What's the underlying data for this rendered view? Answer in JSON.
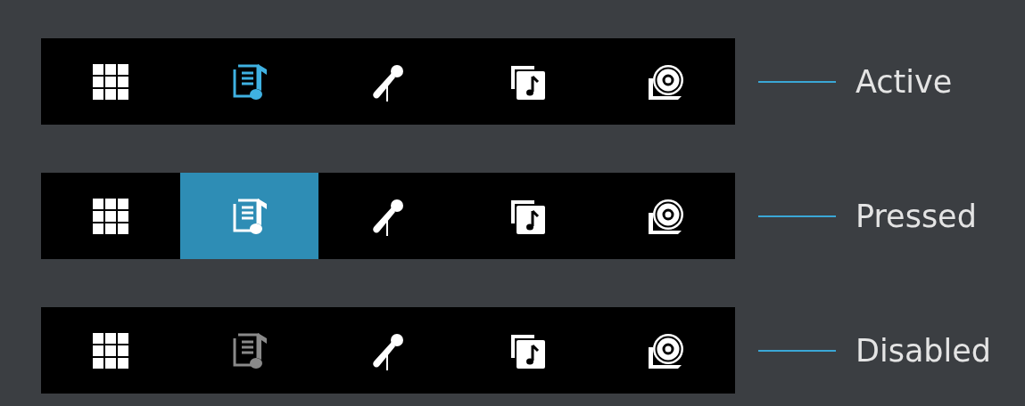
{
  "rows": [
    {
      "label": "Active",
      "kind": "active",
      "tabs": [
        {
          "kind": "grid",
          "selected": false
        },
        {
          "kind": "playlist",
          "selected": true
        },
        {
          "kind": "microphone",
          "selected": false
        },
        {
          "kind": "album",
          "selected": false
        },
        {
          "kind": "disc",
          "selected": false
        }
      ]
    },
    {
      "label": "Pressed",
      "kind": "pressed",
      "tabs": [
        {
          "kind": "grid",
          "selected": false
        },
        {
          "kind": "playlist",
          "selected": true
        },
        {
          "kind": "microphone",
          "selected": false
        },
        {
          "kind": "album",
          "selected": false
        },
        {
          "kind": "disc",
          "selected": false
        }
      ]
    },
    {
      "label": "Disabled",
      "kind": "disabled",
      "tabs": [
        {
          "kind": "grid",
          "selected": false
        },
        {
          "kind": "playlist",
          "selected": true
        },
        {
          "kind": "microphone",
          "selected": false
        },
        {
          "kind": "album",
          "selected": false
        },
        {
          "kind": "disc",
          "selected": false
        }
      ]
    }
  ]
}
